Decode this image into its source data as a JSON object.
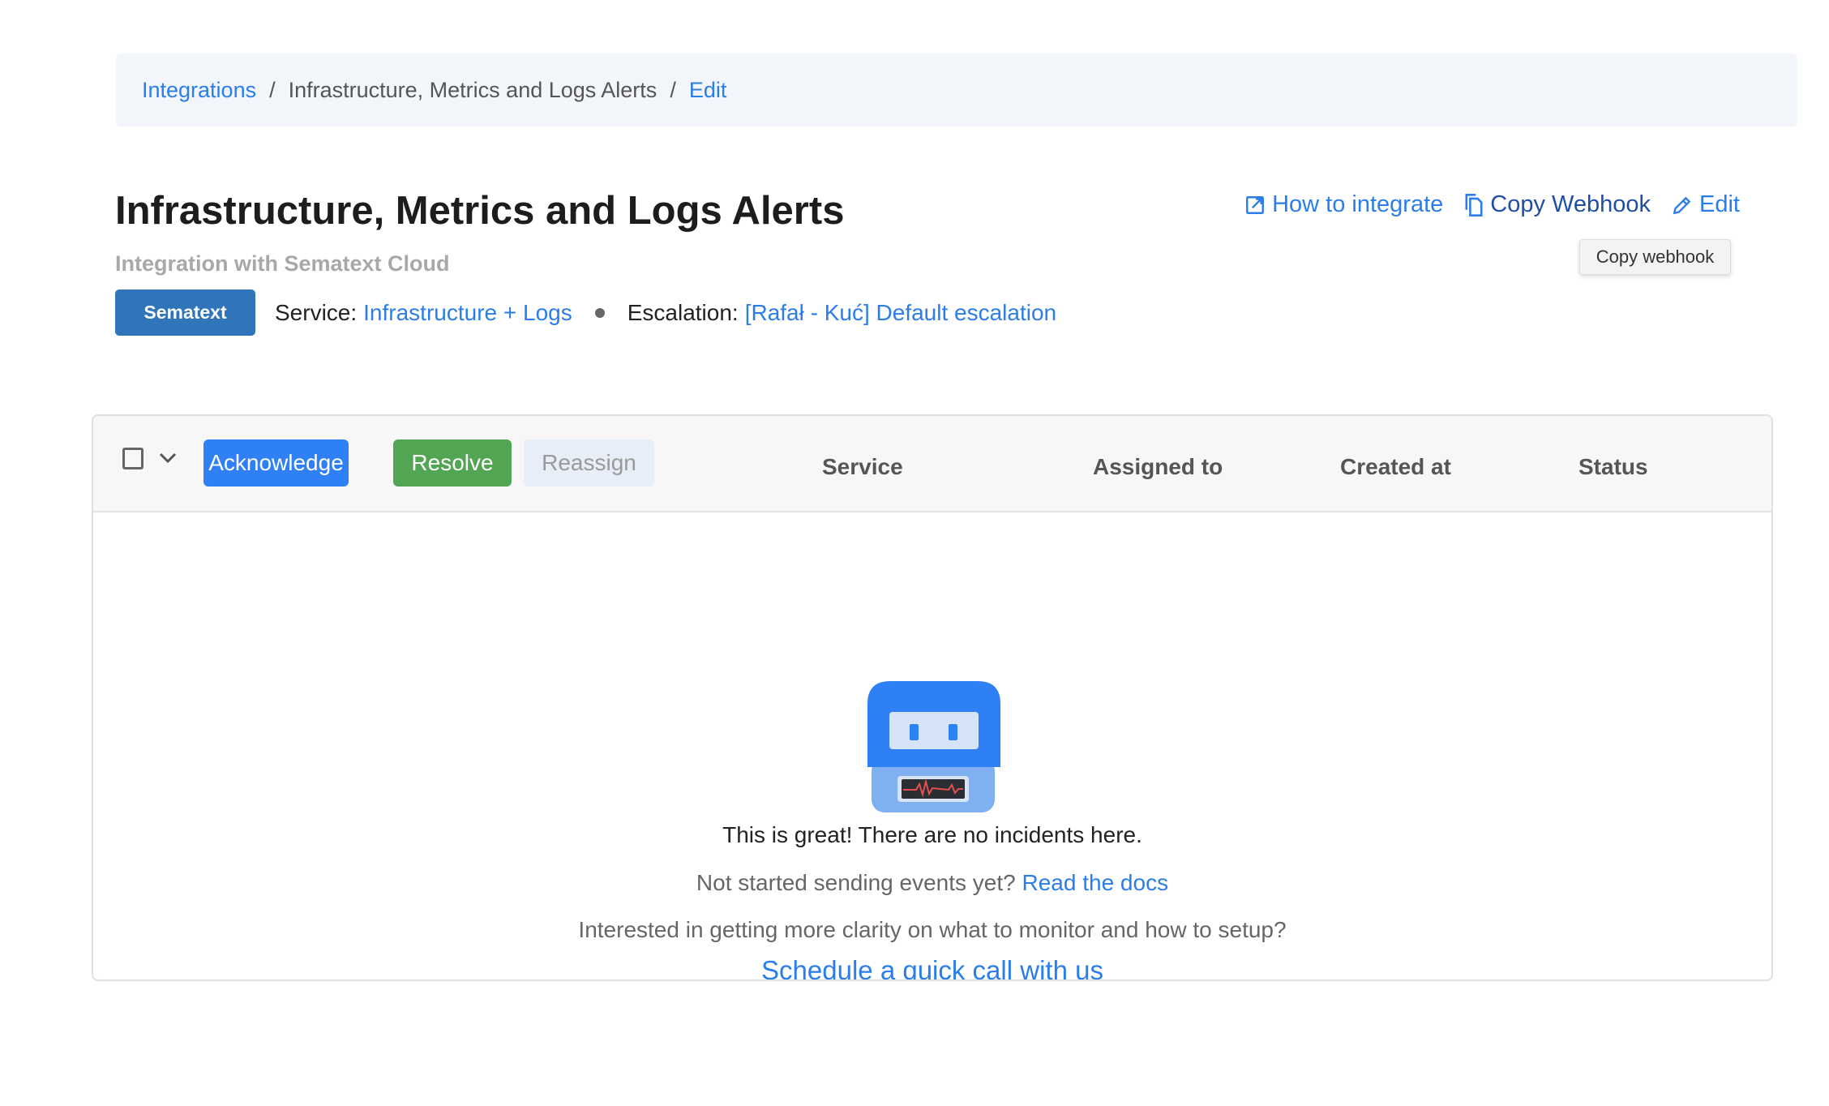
{
  "breadcrumb": {
    "items": [
      {
        "label": "Integrations",
        "link": true
      },
      {
        "label": "Infrastructure, Metrics and Logs Alerts",
        "link": false
      },
      {
        "label": "Edit",
        "link": true
      }
    ],
    "separator": "/"
  },
  "header": {
    "title": "Infrastructure, Metrics and Logs Alerts",
    "subtitle": "Integration with Sematext Cloud",
    "badge": "Sematext",
    "service_label": "Service:",
    "service_value": "Infrastructure + Logs",
    "escalation_label": "Escalation:",
    "escalation_value": "[Rafał - Kuć] Default escalation"
  },
  "actions": {
    "how_to_integrate": "How to integrate",
    "copy_webhook": "Copy Webhook",
    "edit": "Edit",
    "tooltip": "Copy webhook"
  },
  "table": {
    "buttons": {
      "acknowledge": "Acknowledge",
      "resolve": "Resolve",
      "reassign": "Reassign"
    },
    "columns": [
      "Service",
      "Assigned to",
      "Created at",
      "Status"
    ],
    "rows": []
  },
  "empty_state": {
    "headline": "This is great! There are no incidents here.",
    "docs_prompt": "Not started sending events yet?",
    "docs_link": "Read the docs",
    "clarity_prompt": "Interested in getting more clarity on what to monitor and how to setup?",
    "call_link": "Schedule a quick call with us"
  },
  "colors": {
    "primary": "#2f80f5",
    "success": "#52a552",
    "badge": "#3074b9",
    "link": "#2b7de9"
  }
}
